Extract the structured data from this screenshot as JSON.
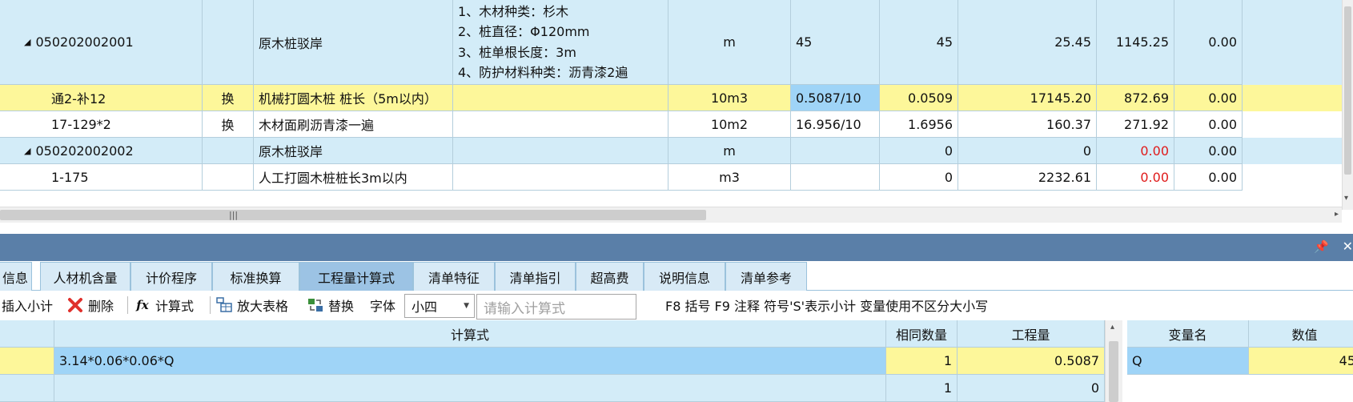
{
  "top_grid": {
    "rows": [
      {
        "code": "050202002001",
        "type": "",
        "name": "原木桩驳岸",
        "features": [
          "1、木材种类：杉木",
          "2、桩直径：Φ120mm",
          "3、桩单根长度：3m",
          "4、防护材料种类：沥青漆2遍"
        ],
        "unit": "m",
        "qty_expr": "45",
        "qty": "45",
        "price": "25.45",
        "total": "1145.25",
        "last": "0.00"
      },
      {
        "code": "通2-补12",
        "type": "换",
        "name": "机械打圆木桩 桩长（5m以内）",
        "features": [],
        "unit": "10m3",
        "qty_expr": "0.5087/10",
        "qty": "0.0509",
        "price": "17145.20",
        "total": "872.69",
        "last": "0.00"
      },
      {
        "code": "17-129*2",
        "type": "换",
        "name": "木材面刷沥青漆一遍",
        "features": [],
        "unit": "10m2",
        "qty_expr": "16.956/10",
        "qty": "1.6956",
        "price": "160.37",
        "total": "271.92",
        "last": "0.00"
      },
      {
        "code": "050202002002",
        "type": "",
        "name": "原木桩驳岸",
        "features": [],
        "unit": "m",
        "qty_expr": "",
        "qty": "0",
        "price": "0",
        "total": "0.00",
        "last": "0.00"
      },
      {
        "code": "1-175",
        "type": "",
        "name": "人工打圆木桩桩长3m以内",
        "features": [],
        "unit": "m3",
        "qty_expr": "",
        "qty": "0",
        "price": "2232.61",
        "total": "0.00",
        "last": "0.00"
      }
    ],
    "colors": {
      "blue_row": "#d3ecf8",
      "yellow_row": "#fdf79a",
      "selected_cell": "#9fd4f7",
      "negative_red": "#e01b1b"
    }
  },
  "panel": {
    "tabs": [
      "信息",
      "人材机含量",
      "计价程序",
      "标准换算",
      "工程量计算式",
      "清单特征",
      "清单指引",
      "超高费",
      "说明信息",
      "清单参考"
    ],
    "active_tab": "工程量计算式",
    "toolbar": {
      "insert_subtotal": "插入小计",
      "delete": "删除",
      "formula": "计算式",
      "enlarge_table": "放大表格",
      "replace": "替换",
      "font_label": "字体",
      "font_value": "小四",
      "formula_placeholder": "请输入计算式",
      "hint": "F8 括号 F9 注释 符号'S'表示小计 变量使用不区分大小写"
    },
    "calc_grid": {
      "headers": [
        "计算式",
        "相同数量",
        "工程量"
      ],
      "rows": [
        {
          "expr": "3.14*0.06*0.06*Q",
          "same_qty": "1",
          "quantity": "0.5087"
        },
        {
          "expr": "",
          "same_qty": "1",
          "quantity": "0"
        }
      ]
    },
    "var_grid": {
      "headers": [
        "变量名",
        "数值"
      ],
      "rows": [
        {
          "name": "Q",
          "value": "45"
        }
      ]
    }
  }
}
